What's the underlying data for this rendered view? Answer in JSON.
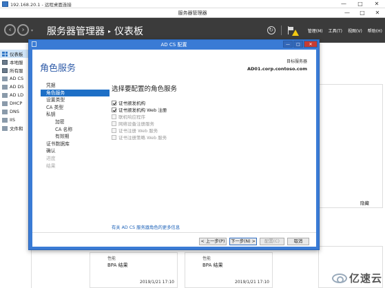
{
  "rdp": {
    "title": "192.168.20.1 - 远程桌面连接",
    "minimize": "—",
    "restore": "□",
    "close": "✕"
  },
  "window": {
    "title": "服务器管理器",
    "minimize": "—",
    "maximize": "□",
    "close": "✕"
  },
  "header": {
    "back": "‹",
    "forward": "›",
    "dropdown": "▾",
    "app_name": "服务器管理器",
    "separator": "▸",
    "page": "仪表板",
    "refresh": "↻",
    "menu": [
      "管理(M)",
      "工具(T)",
      "视图(V)",
      "帮助(H)"
    ]
  },
  "sidebar": {
    "items": [
      {
        "label": "仪表板",
        "icon": "dashboard-icon"
      },
      {
        "label": "本地服",
        "icon": "server-icon"
      },
      {
        "label": "所有服",
        "icon": "servers-icon"
      },
      {
        "label": "AD CS",
        "icon": "role-icon"
      },
      {
        "label": "AD DS",
        "icon": "role-icon"
      },
      {
        "label": "AD LD",
        "icon": "role-icon"
      },
      {
        "label": "DHCP",
        "icon": "role-icon"
      },
      {
        "label": "DNS",
        "icon": "role-icon"
      },
      {
        "label": "IIS",
        "icon": "role-icon"
      },
      {
        "label": "文件和",
        "icon": "role-icon"
      }
    ]
  },
  "right": {
    "hide": "隐藏"
  },
  "tiles": [
    {
      "sub": "性能",
      "bpa": "BPA 结果",
      "timestamp": "2019/1/21 17:10"
    },
    {
      "sub": "性能",
      "bpa": "BPA 结果",
      "timestamp": "2019/1/21 17:10"
    }
  ],
  "dialog": {
    "title": "AD CS 配置",
    "heading": "角色服务",
    "target_label": "目标服务器",
    "target_server": "AD01.corp.contoso.com",
    "controls": {
      "min": "—",
      "max": "□",
      "close": "✕"
    },
    "steps": [
      {
        "label": "凭据",
        "state": "normal",
        "indent": false
      },
      {
        "label": "角色服务",
        "state": "active",
        "indent": false
      },
      {
        "label": "设置类型",
        "state": "normal",
        "indent": false
      },
      {
        "label": "CA 类型",
        "state": "normal",
        "indent": false
      },
      {
        "label": "私钥",
        "state": "normal",
        "indent": false
      },
      {
        "label": "加密",
        "state": "normal",
        "indent": true
      },
      {
        "label": "CA 名称",
        "state": "normal",
        "indent": true
      },
      {
        "label": "有效期",
        "state": "normal",
        "indent": true
      },
      {
        "label": "证书数据库",
        "state": "normal",
        "indent": false
      },
      {
        "label": "确认",
        "state": "normal",
        "indent": false
      },
      {
        "label": "进度",
        "state": "disabled",
        "indent": false
      },
      {
        "label": "结果",
        "state": "disabled",
        "indent": false
      }
    ],
    "main_title": "选择要配置的角色服务",
    "roles": [
      {
        "label": "证书颁发机构",
        "checked": true,
        "enabled": true
      },
      {
        "label": "证书颁发机构 Web 注册",
        "checked": true,
        "enabled": true
      },
      {
        "label": "联机响应程序",
        "checked": false,
        "enabled": false
      },
      {
        "label": "网络设备注册服务",
        "checked": false,
        "enabled": false
      },
      {
        "label": "证书注册 Web 服务",
        "checked": false,
        "enabled": false
      },
      {
        "label": "证书注册策略 Web 服务",
        "checked": false,
        "enabled": false
      }
    ],
    "more_link": "有关 AD CS 服务器角色的更多信息",
    "buttons": {
      "prev": "< 上一步(P)",
      "next": "下一步(N) >",
      "configure": "配置(C)",
      "cancel": "取消"
    }
  },
  "watermark": {
    "text": "亿速云"
  }
}
